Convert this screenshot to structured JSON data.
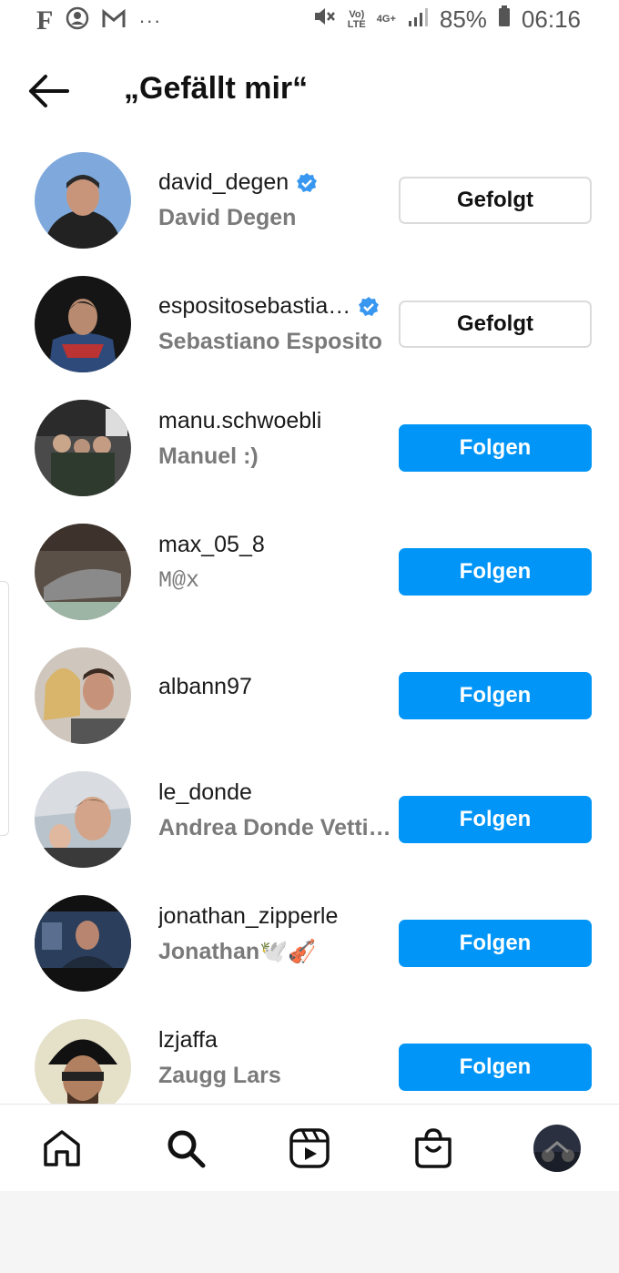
{
  "status_bar": {
    "left_icons": [
      "facebook-icon",
      "messenger-icon",
      "gmail-icon",
      "more-icon"
    ],
    "volte": "Vo)\nLTE",
    "network": "4G+",
    "battery": "85%",
    "time": "06:16"
  },
  "header": {
    "title": "„Gefällt mir“"
  },
  "users": [
    {
      "username": "david_degen",
      "fullname": "David Degen",
      "verified": true,
      "button": "Gefolgt",
      "state": "following"
    },
    {
      "username": "espositosebastia…",
      "fullname": "Sebastiano Esposito",
      "verified": true,
      "button": "Gefolgt",
      "state": "following"
    },
    {
      "username": "manu.schwoebli",
      "fullname": "Manuel :)",
      "verified": false,
      "button": "Folgen",
      "state": "follow"
    },
    {
      "username": "max_05_8",
      "fullname": "M@x",
      "verified": false,
      "button": "Folgen",
      "state": "follow"
    },
    {
      "username": "albann97",
      "fullname": "",
      "verified": false,
      "button": "Folgen",
      "state": "follow"
    },
    {
      "username": "le_donde",
      "fullname": "Andrea Donde Vettig…",
      "verified": false,
      "button": "Folgen",
      "state": "follow"
    },
    {
      "username": "jonathan_zipperle",
      "fullname": "Jonathan🕊️🎻",
      "verified": false,
      "button": "Folgen",
      "state": "follow"
    },
    {
      "username": "lzjaffa",
      "fullname": "Zaugg Lars",
      "verified": false,
      "button": "Folgen",
      "state": "follow"
    }
  ],
  "bottom_nav": {
    "items": [
      "home-icon",
      "search-icon",
      "reels-icon",
      "shop-icon",
      "profile-avatar"
    ]
  },
  "colors": {
    "follow_button": "#0095f6",
    "verified_badge": "#3897f0",
    "secondary_text": "#7a7a7a"
  }
}
